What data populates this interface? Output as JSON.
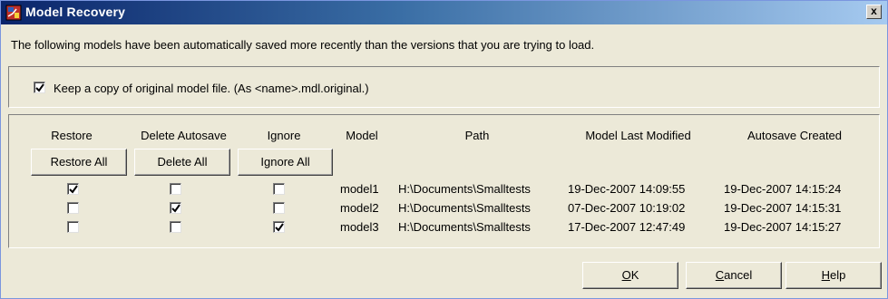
{
  "window": {
    "title": "Model Recovery",
    "close_glyph": "x",
    "icon": "simulink-app-icon"
  },
  "message": "The following models have been automatically saved more recently than the versions that you are trying to load.",
  "keep_copy": {
    "checked": true,
    "label": "Keep a copy of original model file. (As <name>.mdl.original.)"
  },
  "columns": {
    "restore": "Restore",
    "delete_autosave": "Delete Autosave",
    "ignore": "Ignore",
    "model": "Model",
    "path": "Path",
    "model_last_modified": "Model Last Modified",
    "autosave_created": "Autosave Created"
  },
  "bulk_buttons": {
    "restore_all": "Restore All",
    "delete_all": "Delete All",
    "ignore_all": "Ignore All"
  },
  "rows": [
    {
      "restore": true,
      "delete": false,
      "ignore": false,
      "model": "model1",
      "path": "H:\\Documents\\Smalltests",
      "modified": "19-Dec-2007 14:09:55",
      "autosave": "19-Dec-2007 14:15:24"
    },
    {
      "restore": false,
      "delete": true,
      "ignore": false,
      "model": "model2",
      "path": "H:\\Documents\\Smalltests",
      "modified": "07-Dec-2007 10:19:02",
      "autosave": "19-Dec-2007 14:15:31"
    },
    {
      "restore": false,
      "delete": false,
      "ignore": true,
      "model": "model3",
      "path": "H:\\Documents\\Smalltests",
      "modified": "17-Dec-2007 12:47:49",
      "autosave": "19-Dec-2007 14:15:27"
    }
  ],
  "footer": {
    "ok": {
      "pre": "",
      "mnemonic": "O",
      "post": "K"
    },
    "cancel": {
      "pre": "",
      "mnemonic": "C",
      "post": "ancel"
    },
    "help": {
      "pre": "",
      "mnemonic": "H",
      "post": "elp"
    }
  },
  "colors": {
    "title_gradient_start": "#0a246a",
    "title_gradient_end": "#a6caf0",
    "dialog_bg": "#ece9d8"
  }
}
